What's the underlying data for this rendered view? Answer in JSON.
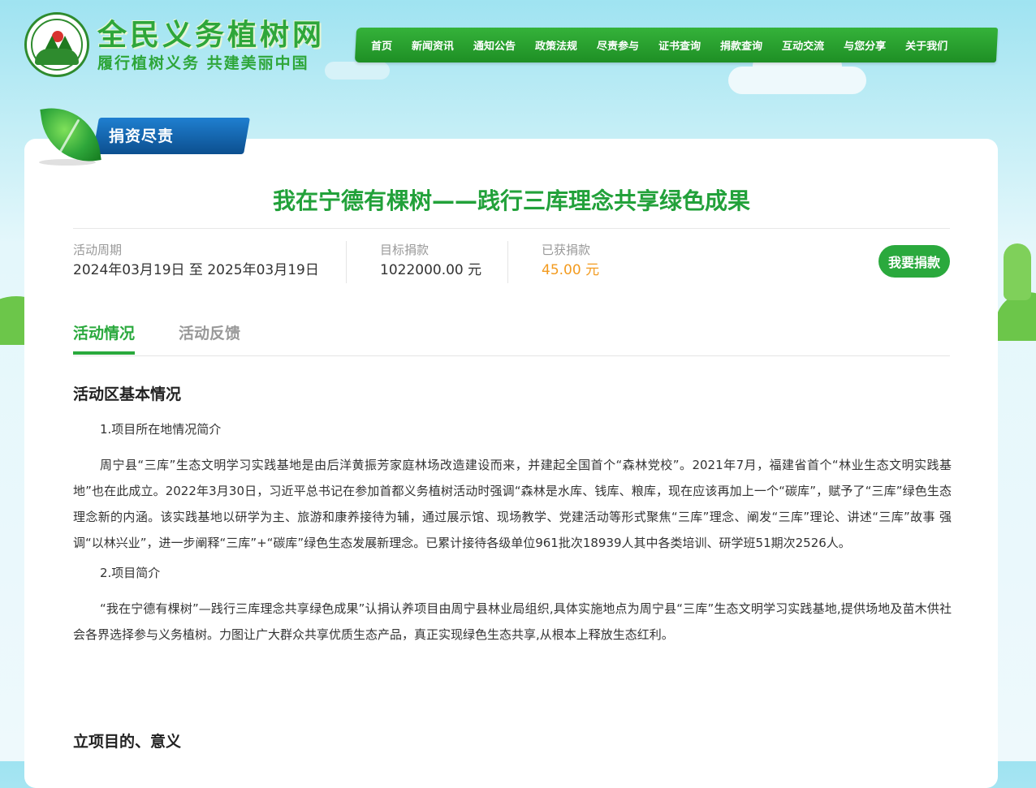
{
  "site": {
    "title": "全民义务植树网",
    "slogan": "履行植树义务  共建美丽中国",
    "logo_text": "全民义务植树网"
  },
  "nav": {
    "items": [
      "首页",
      "新闻资讯",
      "通知公告",
      "政策法规",
      "尽责参与",
      "证书查询",
      "捐款查询",
      "互动交流",
      "与您分享",
      "关于我们"
    ]
  },
  "section_tag": "捐资尽责",
  "project": {
    "title": "我在宁德有棵树——践行三库理念共享绿色成果",
    "period_label": "活动周期",
    "period_value": "2024年03月19日 至 2025年03月19日",
    "target_label": "目标捐款",
    "target_value": "1022000.00 元",
    "raised_label": "已获捐款",
    "raised_value": "45.00 元",
    "donate_button": "我要捐款"
  },
  "tabs": {
    "active": "活动情况",
    "inactive": "活动反馈"
  },
  "content": {
    "heading1": "活动区基本情况",
    "sub1": "1.项目所在地情况简介",
    "para1": "周宁县“三库”生态文明学习实践基地是由后洋黄振芳家庭林场改造建设而来，并建起全国首个“森林党校”。2021年7月，福建省首个“林业生态文明实践基地”也在此成立。2022年3月30日，习近平总书记在参加首都义务植树活动时强调“森林是水库、钱库、粮库，现在应该再加上一个“碳库”，赋予了“三库”绿色生态理念新的内涵。该实践基地以研学为主、旅游和康养接待为辅，通过展示馆、现场教学、党建活动等形式聚焦“三库”理念、阐发“三库”理论、讲述“三库”故事 强调“以林兴业”，进一步阐释“三库”+“碳库”绿色生态发展新理念。已累计接待各级单位961批次18939人其中各类培训、研学班51期次2526人。",
    "sub2": "2.项目简介",
    "para2": "“我在宁德有棵树”—践行三库理念共享绿色成果”认捐认养项目由周宁县林业局组织,具体实施地点为周宁县“三库”生态文明学习实践基地,提供场地及苗木供社会各界选择参与义务植树。力图让广大群众共享优质生态产品，真正实现绿色生态共享,从根本上释放生态红利。",
    "heading2": "立项目的、意义"
  },
  "colors": {
    "brand_green": "#2aa93d",
    "title_green": "#22a13a",
    "raised_orange": "#f39b1f",
    "tag_blue": "#0c4f8f"
  }
}
